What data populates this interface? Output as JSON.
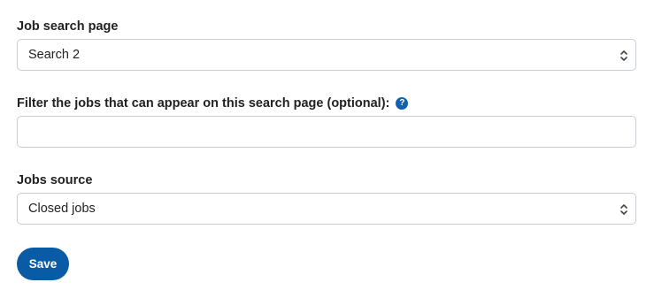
{
  "form": {
    "job_search_page": {
      "label": "Job search page",
      "selected": "Search 2"
    },
    "filter": {
      "label": "Filter the jobs that can appear on this search page (optional):",
      "help_glyph": "?",
      "value": "",
      "icon": "question-circle-icon"
    },
    "jobs_source": {
      "label": "Jobs source",
      "selected": "Closed jobs"
    },
    "save_label": "Save"
  },
  "colors": {
    "accent": "#0a5ba6",
    "help_icon": "#1060b0",
    "border": "#c9ced4"
  }
}
